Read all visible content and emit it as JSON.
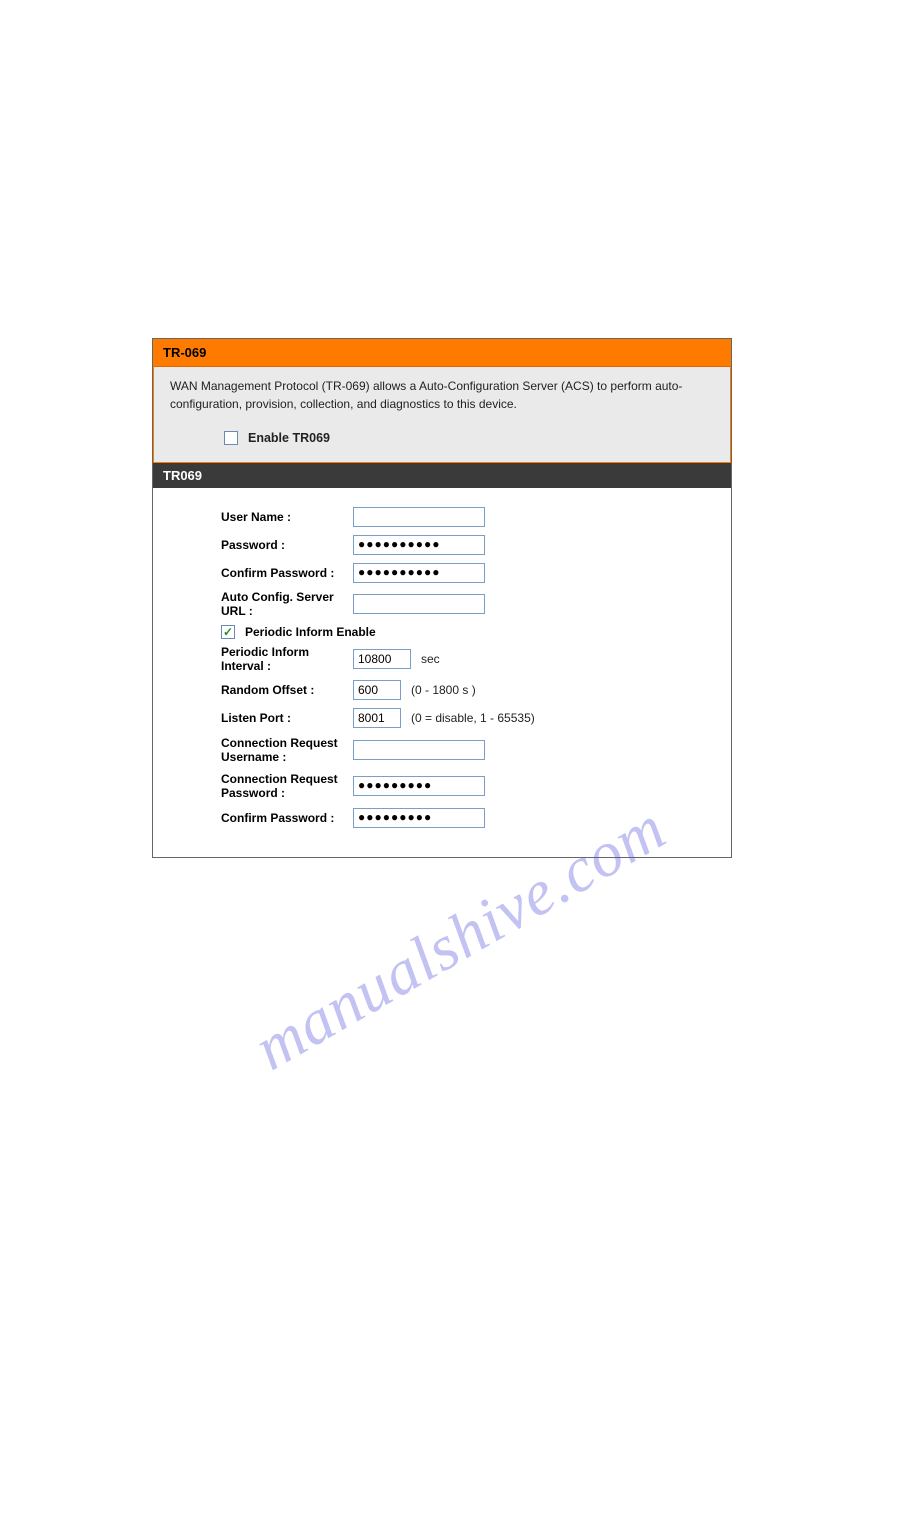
{
  "watermark": "manualshive.com",
  "header": {
    "title": "TR-069"
  },
  "intro": {
    "text": "WAN Management Protocol (TR-069) allows a Auto-Configuration Server (ACS) to perform auto-configuration, provision, collection, and diagnostics to this device.",
    "enable_label": "Enable TR069",
    "enable_checked": false
  },
  "section": {
    "title": "TR069"
  },
  "form": {
    "username": {
      "label": "User Name :",
      "value": ""
    },
    "password": {
      "label": "Password :",
      "value": "●●●●●●●●●●"
    },
    "confirm_password": {
      "label": "Confirm Password :",
      "value": "●●●●●●●●●●"
    },
    "acs_url": {
      "label": "Auto Config. Server URL :",
      "value": ""
    },
    "periodic_inform_enable": {
      "label": "Periodic Inform Enable",
      "checked": true
    },
    "periodic_interval": {
      "label": "Periodic Inform Interval :",
      "value": "10800",
      "hint": "sec"
    },
    "random_offset": {
      "label": "Random Offset :",
      "value": "600",
      "hint": "(0 - 1800 s )"
    },
    "listen_port": {
      "label": "Listen Port :",
      "value": "8001",
      "hint": "(0 = disable, 1 - 65535)"
    },
    "conn_req_user": {
      "label": "Connection Request Username :",
      "value": ""
    },
    "conn_req_pass": {
      "label": "Connection Request Password :",
      "value": "●●●●●●●●●"
    },
    "conn_req_confirm": {
      "label": "Confirm Password :",
      "value": "●●●●●●●●●"
    }
  }
}
